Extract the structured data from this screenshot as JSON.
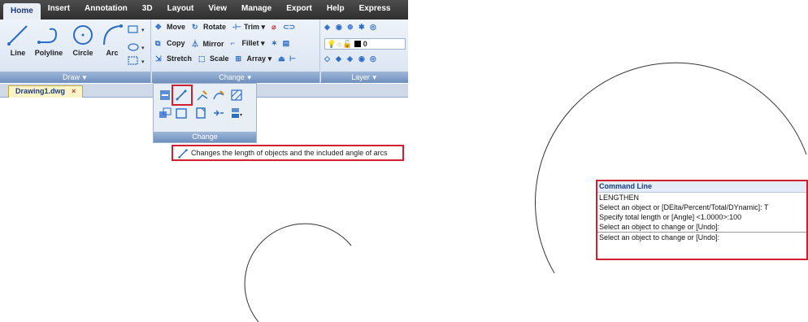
{
  "ribbon_tabs": [
    "Home",
    "Insert",
    "Annotation",
    "3D",
    "Layout",
    "View",
    "Manage",
    "Export",
    "Help",
    "Express"
  ],
  "draw_panel": {
    "tools": [
      "Line",
      "Polyline",
      "Circle",
      "Arc"
    ],
    "title": "Draw"
  },
  "change_panel": {
    "row1": [
      "Move",
      "Rotate",
      "Trim"
    ],
    "row2": [
      "Copy",
      "Mirror",
      "Fillet"
    ],
    "row3": [
      "Stretch",
      "Scale",
      "Array"
    ],
    "title": "Change"
  },
  "layer_panel": {
    "layer_value": "0",
    "title": "Layer"
  },
  "document_tab": {
    "name": "Drawing1.dwg",
    "close": "×"
  },
  "change_dropdown": {
    "title": "Change"
  },
  "tooltip": {
    "text": "Changes the length of objects and the included angle of arcs"
  },
  "command_line": {
    "header": "Command Line",
    "lines": [
      "LENGTHEN",
      "Select an object or [DElta/Percent/Total/DYnamic]: T",
      "Specify total length or [Angle] <1.0000>:100",
      "Select an object to change or [Undo]:"
    ],
    "input": "Select an object to change or [Undo]:"
  },
  "colors": {
    "highlight": "#d01f2e",
    "ribbon_dark": "#2f2f2f",
    "accent": "#1a3c7a"
  }
}
